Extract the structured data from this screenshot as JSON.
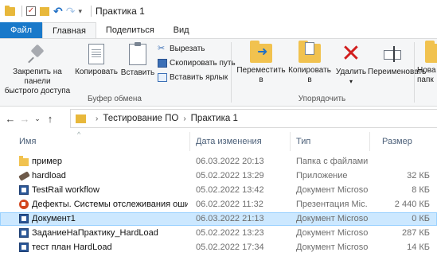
{
  "window": {
    "title": "Практика 1"
  },
  "tabs": [
    {
      "label": "Файл"
    },
    {
      "label": "Главная"
    },
    {
      "label": "Поделиться"
    },
    {
      "label": "Вид"
    }
  ],
  "ribbon": {
    "clipboard": {
      "group_label": "Буфер обмена",
      "pin_label": "Закрепить на панели быстрого доступа",
      "pin_line1": "Закрепить на панели",
      "pin_line2": "быстрого доступа",
      "copy_label": "Копировать",
      "paste_label": "Вставить",
      "cut_label": "Вырезать",
      "copy_path_label": "Скопировать путь",
      "paste_shortcut_label": "Вставить ярлык"
    },
    "organize": {
      "group_label": "Упорядочить",
      "move_line1": "Переместить",
      "move_line2": "в",
      "copy_line1": "Копировать",
      "copy_line2": "в",
      "delete_label": "Удалить",
      "rename_label": "Переименовать",
      "new_partial_line1": "Нова",
      "new_partial_line2": "папк"
    }
  },
  "address": {
    "crumbs": [
      "Тестирование ПО",
      "Практика 1"
    ]
  },
  "columns": {
    "name": "Имя",
    "date": "Дата изменения",
    "type": "Тип",
    "size": "Размер"
  },
  "files": [
    {
      "name": "пример",
      "date": "06.03.2022 20:13",
      "type": "Папка с файлами",
      "size": "",
      "icon": "folder-icon"
    },
    {
      "name": "hardload",
      "date": "05.02.2022 13:29",
      "type": "Приложение",
      "size": "32 КБ",
      "icon": "app-icon"
    },
    {
      "name": "TestRail workflow",
      "date": "05.02.2022 13:42",
      "type": "Документ Microso...",
      "size": "8 КБ",
      "icon": "word-doc-icon"
    },
    {
      "name": "Дефекты. Системы отслеживания оши...",
      "date": "06.02.2022 11:32",
      "type": "Презентация Mic...",
      "size": "2 440 КБ",
      "icon": "powerpoint-icon"
    },
    {
      "name": "Документ1",
      "date": "06.03.2022 21:13",
      "type": "Документ Microso...",
      "size": "0 КБ",
      "icon": "word-doc-icon",
      "selected": true
    },
    {
      "name": "ЗаданиеНаПрактику_HardLoad",
      "date": "05.02.2022 13:23",
      "type": "Документ Microso...",
      "size": "287 КБ",
      "icon": "word-doc-icon"
    },
    {
      "name": "тест план HardLoad",
      "date": "05.02.2022 17:34",
      "type": "Документ Microso...",
      "size": "14 КБ",
      "icon": "word-doc-icon"
    }
  ]
}
